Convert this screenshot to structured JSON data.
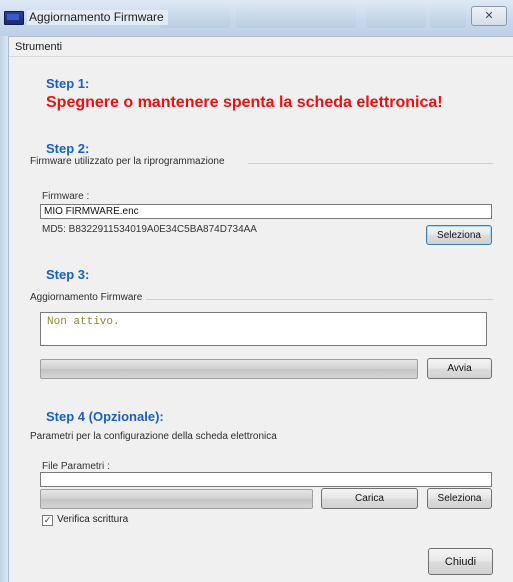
{
  "window": {
    "title": "Aggiornamento Firmware",
    "close_symbol": "✕"
  },
  "menu": {
    "items": [
      "Strumenti"
    ]
  },
  "step1": {
    "title": "Step 1:",
    "message": "Spegnere o mantenere spenta la scheda elettronica!"
  },
  "step2": {
    "title": "Step 2:",
    "group_label": "Firmware utilizzato per la riprogrammazione",
    "firmware_label": "Firmware :",
    "firmware_value": "MIO FIRMWARE.enc",
    "md5": "MD5: B8322911534019A0E34C5BA874D734AA",
    "select_button": "Seleziona"
  },
  "step3": {
    "title": "Step 3:",
    "group_label": "Aggiornamento Firmware",
    "status_text": "Non attivo.",
    "progress": 0,
    "start_button": "Avvia"
  },
  "step4": {
    "title": "Step 4 (Opzionale):",
    "group_label": "Parametri per la configurazione della scheda elettronica",
    "params_label": "File Parametri :",
    "params_value": "",
    "progress": 0,
    "load_button": "Carica",
    "select_button": "Seleziona",
    "verify_label": "Verifica scrittura",
    "verify_checked": true,
    "check_mark": "✓"
  },
  "footer": {
    "close_button": "Chiudi"
  },
  "colors": {
    "step_title": "#1b5fc4",
    "warning": "#ee1010",
    "status_text": "#8f8a3a"
  }
}
